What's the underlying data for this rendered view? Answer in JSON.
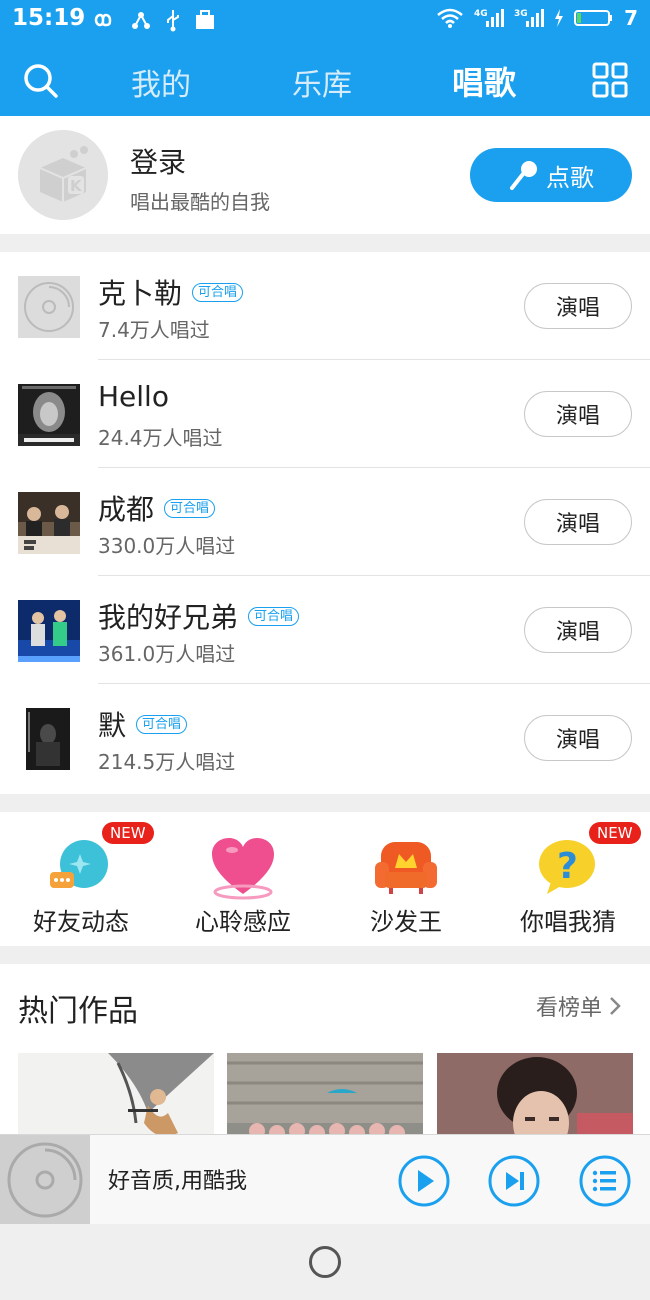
{
  "status": {
    "time": "15:19",
    "battery": "7",
    "net1": "4G",
    "net2": "3G"
  },
  "nav": {
    "tabs": [
      {
        "label": "我的"
      },
      {
        "label": "乐库"
      },
      {
        "label": "唱歌"
      }
    ],
    "active": "唱歌"
  },
  "profile": {
    "login": "登录",
    "tagline": "唱出最酷的自我",
    "order_button": "点歌"
  },
  "songs": [
    {
      "title": "克卜勒",
      "chorus": "可合唱",
      "count": "7.4万人唱过",
      "action": "演唱"
    },
    {
      "title": "Hello",
      "chorus": "",
      "count": "24.4万人唱过",
      "action": "演唱"
    },
    {
      "title": "成都",
      "chorus": "可合唱",
      "count": "330.0万人唱过",
      "action": "演唱"
    },
    {
      "title": "我的好兄弟",
      "chorus": "可合唱",
      "count": "361.0万人唱过",
      "action": "演唱"
    },
    {
      "title": "默",
      "chorus": "可合唱",
      "count": "214.5万人唱过",
      "action": "演唱"
    }
  ],
  "features": [
    {
      "label": "好友动态",
      "badge": "NEW",
      "icon": "chat-bubble-icon"
    },
    {
      "label": "心聆感应",
      "badge": "",
      "icon": "heart-icon"
    },
    {
      "label": "沙发王",
      "badge": "",
      "icon": "sofa-crown-icon"
    },
    {
      "label": "你唱我猜",
      "badge": "NEW",
      "icon": "question-icon"
    }
  ],
  "hot": {
    "title": "热门作品",
    "more": "看榜单"
  },
  "player": {
    "text": "好音质,用酷我"
  },
  "colors": {
    "accent": "#1aa0ee",
    "badge": "#e8211b"
  }
}
